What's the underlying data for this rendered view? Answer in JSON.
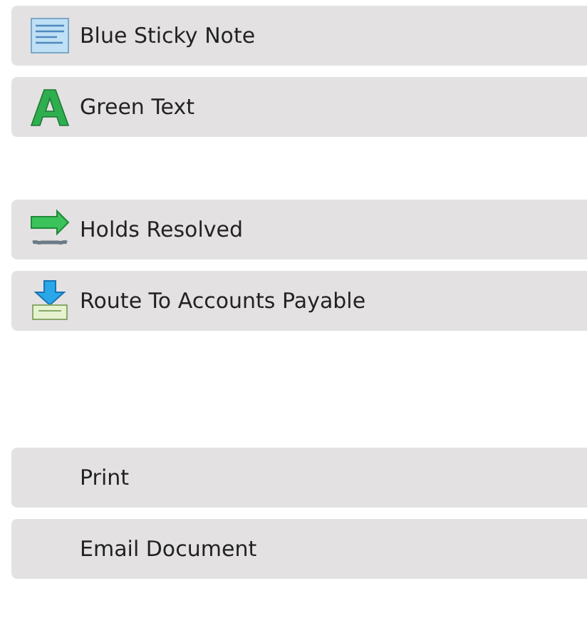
{
  "groups": [
    {
      "items": [
        {
          "label": "Blue Sticky Note",
          "kind": "note"
        },
        {
          "label": "Green Text",
          "kind": "letter"
        }
      ]
    },
    {
      "items": [
        {
          "label": "Holds Resolved",
          "kind": "resolve"
        },
        {
          "label": "Route To Accounts Payable",
          "kind": "route"
        }
      ]
    },
    {
      "items": [
        {
          "label": "Print",
          "kind": "plain"
        },
        {
          "label": "Email Document",
          "kind": "plain"
        }
      ]
    }
  ]
}
